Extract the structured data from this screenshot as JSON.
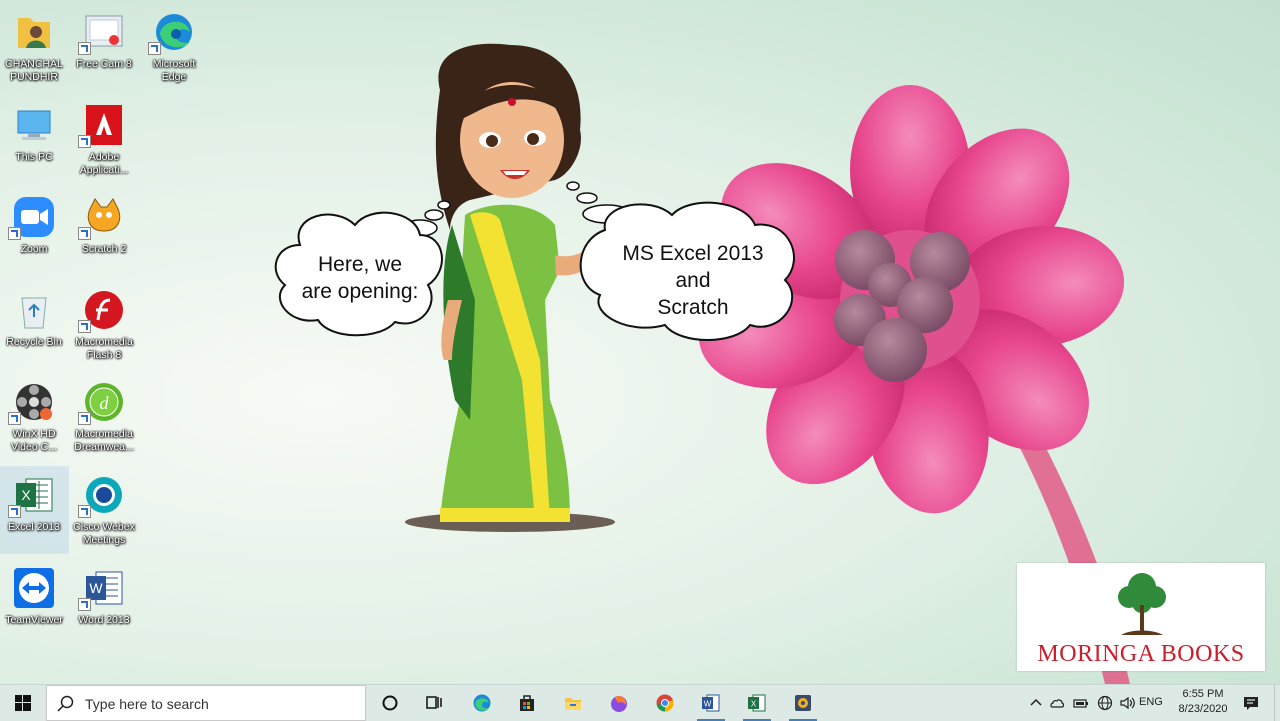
{
  "desktop_icons": [
    {
      "label": "CHANCHAL PUNDHIR",
      "icon": "user-folder-icon"
    },
    {
      "label": "This PC",
      "icon": "computer-icon"
    },
    {
      "label": "Zoom",
      "icon": "zoom-icon"
    },
    {
      "label": "Recycle Bin",
      "icon": "recycle-bin-icon"
    },
    {
      "label": "WinX HD Video C...",
      "icon": "winx-video-icon"
    },
    {
      "label": "Excel 2013",
      "icon": "excel-icon"
    },
    {
      "label": "TeamViewer",
      "icon": "teamviewer-icon"
    },
    {
      "label": "Free Cam 8",
      "icon": "free-cam-icon"
    },
    {
      "label": "Adobe Applicati...",
      "icon": "adobe-icon"
    },
    {
      "label": "Scratch 2",
      "icon": "scratch-icon"
    },
    {
      "label": "Macromedia Flash 8",
      "icon": "flash-icon"
    },
    {
      "label": "Macromedia Dreamwea...",
      "icon": "dreamweaver-icon"
    },
    {
      "label": "Cisco Webex Meetings",
      "icon": "webex-icon"
    },
    {
      "label": "Word 2013",
      "icon": "word-icon"
    },
    {
      "label": "Microsoft Edge",
      "icon": "edge-icon"
    }
  ],
  "bubbles": {
    "left_line1": "Here, we",
    "left_line2": "are opening:",
    "right_line1": "MS Excel 2013",
    "right_line2": "and",
    "right_line3": "Scratch"
  },
  "logo": {
    "text": "MORINGA BOOKS"
  },
  "taskbar": {
    "search_placeholder": "Type here to search",
    "pinned": [
      "cortana-icon",
      "task-view-icon",
      "edge-icon",
      "store-icon",
      "file-explorer-icon",
      "firefox-icon",
      "chrome-icon",
      "word-icon",
      "excel-icon",
      "media-icon"
    ],
    "language": "ENG",
    "time": "6:55 PM",
    "date": "8/23/2020"
  },
  "colors": {
    "flower": "#e8478e",
    "taskbar": "#dce9e4",
    "logo_red": "#c8202c",
    "logo_green": "#2f8a3a"
  }
}
